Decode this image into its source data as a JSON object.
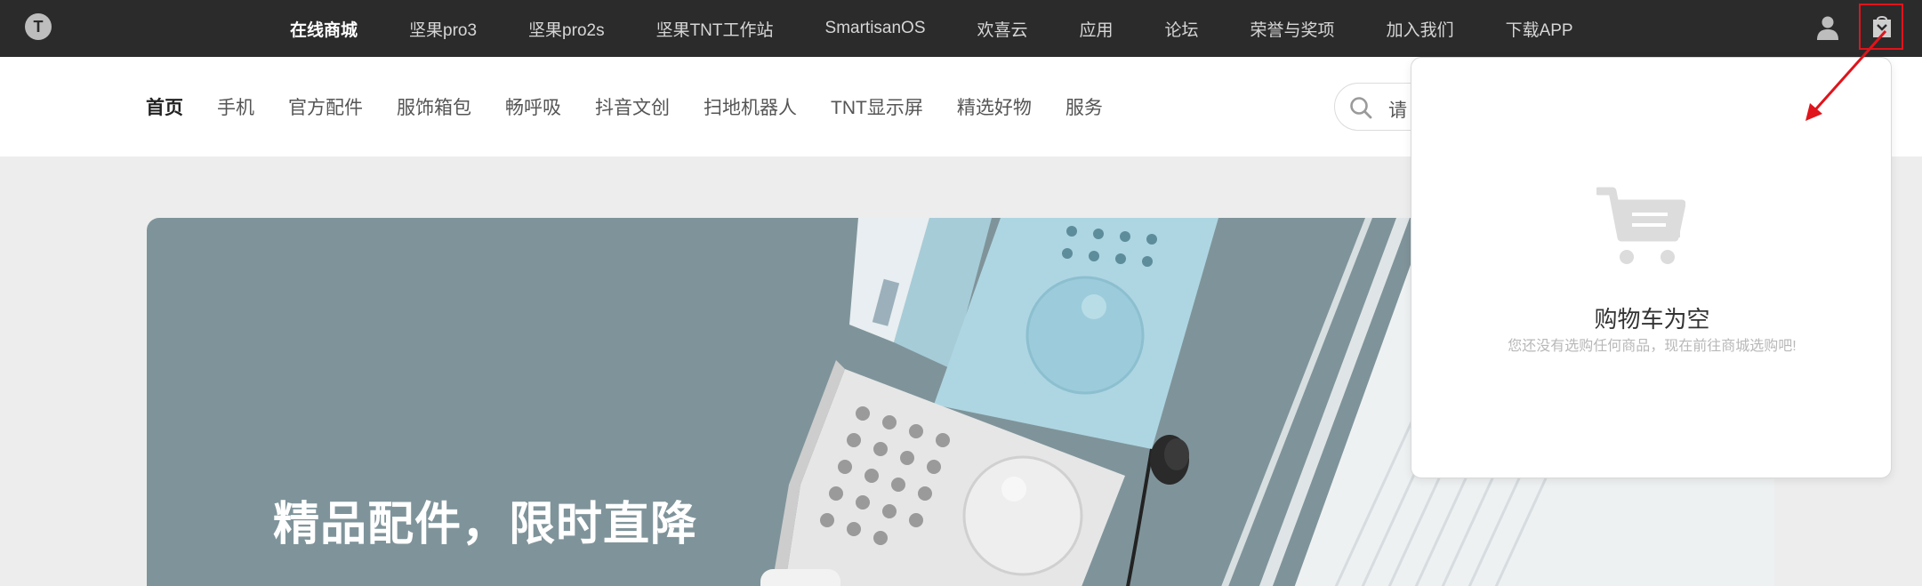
{
  "topbar": {
    "logo_letter": "T",
    "nav": [
      {
        "label": "在线商城",
        "active": true
      },
      {
        "label": "坚果pro3",
        "active": false
      },
      {
        "label": "坚果pro2s",
        "active": false
      },
      {
        "label": "坚果TNT工作站",
        "active": false
      },
      {
        "label": "SmartisanOS",
        "active": false
      },
      {
        "label": "欢喜云",
        "active": false
      },
      {
        "label": "应用",
        "active": false
      },
      {
        "label": "论坛",
        "active": false
      },
      {
        "label": "荣誉与奖项",
        "active": false
      },
      {
        "label": "加入我们",
        "active": false
      },
      {
        "label": "下载APP",
        "active": false
      }
    ],
    "icons": [
      "user-icon",
      "cart-icon"
    ]
  },
  "subnav": {
    "links": [
      {
        "label": "首页",
        "active": true
      },
      {
        "label": "手机",
        "active": false
      },
      {
        "label": "官方配件",
        "active": false
      },
      {
        "label": "服饰箱包",
        "active": false
      },
      {
        "label": "畅呼吸",
        "active": false
      },
      {
        "label": "抖音文创",
        "active": false
      },
      {
        "label": "扫地机器人",
        "active": false
      },
      {
        "label": "TNT显示屏",
        "active": false
      },
      {
        "label": "精选好物",
        "active": false
      },
      {
        "label": "服务",
        "active": false
      }
    ],
    "search": {
      "visible_text": "请"
    }
  },
  "banner": {
    "title": "精品配件，限时直降"
  },
  "cart_panel": {
    "title": "购物车为空",
    "description": "您还没有选购任何商品，现在前往商城选购吧!"
  },
  "colors": {
    "topbar_bg": "#2b2b2c",
    "banner_bg": "#7f949a",
    "annotation_red": "#e0141b",
    "page_bg": "#ededed"
  }
}
